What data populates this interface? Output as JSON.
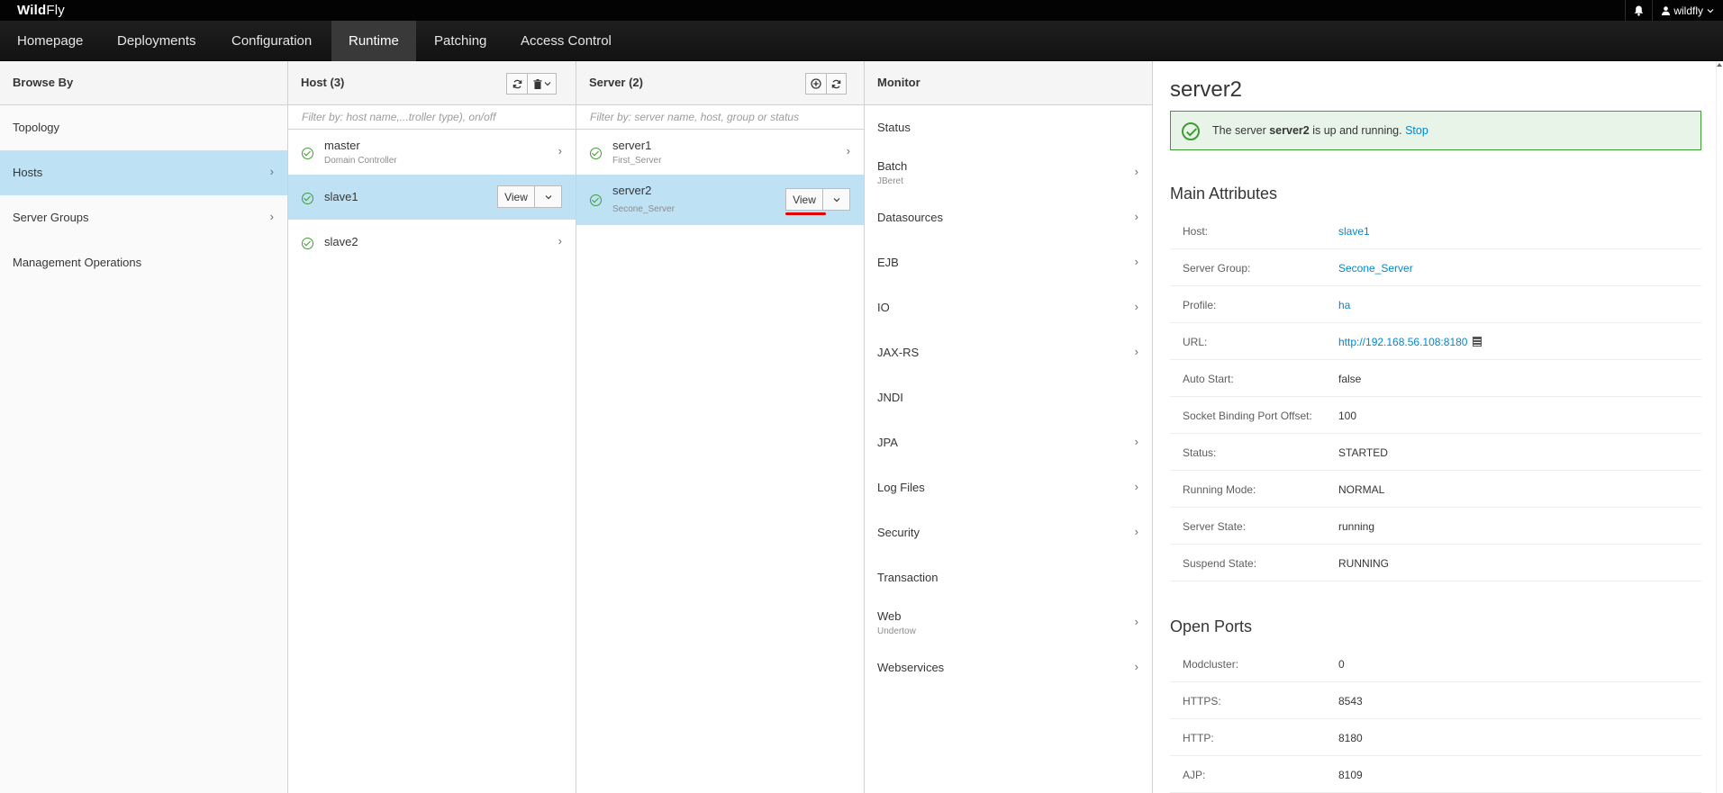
{
  "topbar": {
    "brand_bold": "Wild",
    "brand_rest": "Fly",
    "user": "wildfly"
  },
  "nav": [
    "Homepage",
    "Deployments",
    "Configuration",
    "Runtime",
    "Patching",
    "Access Control"
  ],
  "browse": {
    "title": "Browse By",
    "items": [
      "Topology",
      "Hosts",
      "Server Groups",
      "Management Operations"
    ]
  },
  "hosts": {
    "title": "Host (3)",
    "filter_placeholder": "Filter by: host name,...troller type), on/off",
    "items": [
      {
        "name": "master",
        "sub": "Domain Controller"
      },
      {
        "name": "slave1",
        "view": "View"
      },
      {
        "name": "slave2"
      }
    ]
  },
  "servers": {
    "title": "Server (2)",
    "filter_placeholder": "Filter by: server name, host, group or status",
    "items": [
      {
        "name": "server1",
        "sub": "First_Server"
      },
      {
        "name": "server2",
        "sub": "Secone_Server",
        "view": "View"
      }
    ]
  },
  "monitor": {
    "title": "Monitor",
    "items": [
      {
        "label": "Status"
      },
      {
        "label": "Batch",
        "sub": "JBeret"
      },
      {
        "label": "Datasources"
      },
      {
        "label": "EJB"
      },
      {
        "label": "IO"
      },
      {
        "label": "JAX-RS"
      },
      {
        "label": "JNDI"
      },
      {
        "label": "JPA"
      },
      {
        "label": "Log Files"
      },
      {
        "label": "Security"
      },
      {
        "label": "Transaction"
      },
      {
        "label": "Web",
        "sub": "Undertow"
      },
      {
        "label": "Webservices"
      }
    ]
  },
  "detail": {
    "title": "server2",
    "alert": {
      "prefix": "The server",
      "server": "server2",
      "suffix": "is up and running.",
      "action": "Stop"
    },
    "main_attributes_title": "Main Attributes",
    "attributes": [
      {
        "k": "Host:",
        "v": "slave1"
      },
      {
        "k": "Server Group:",
        "v": "Secone_Server"
      },
      {
        "k": "Profile:",
        "v": "ha"
      },
      {
        "k": "URL:",
        "v": "http://192.168.56.108:8180"
      },
      {
        "k": "Auto Start:",
        "v": "false"
      },
      {
        "k": "Socket Binding Port Offset:",
        "v": "100"
      },
      {
        "k": "Status:",
        "v": "STARTED"
      },
      {
        "k": "Running Mode:",
        "v": "NORMAL"
      },
      {
        "k": "Server State:",
        "v": "running"
      },
      {
        "k": "Suspend State:",
        "v": "RUNNING"
      }
    ],
    "open_ports_title": "Open Ports",
    "ports": [
      {
        "k": "Modcluster:",
        "v": "0"
      },
      {
        "k": "HTTPS:",
        "v": "8543"
      },
      {
        "k": "HTTP:",
        "v": "8180"
      },
      {
        "k": "AJP:",
        "v": "8109"
      }
    ]
  },
  "colors": {
    "selected": "#bee1f4",
    "ok": "#3f9c35",
    "link": "#0088ce",
    "nav_active": "#393939",
    "underline": "#e00000"
  }
}
